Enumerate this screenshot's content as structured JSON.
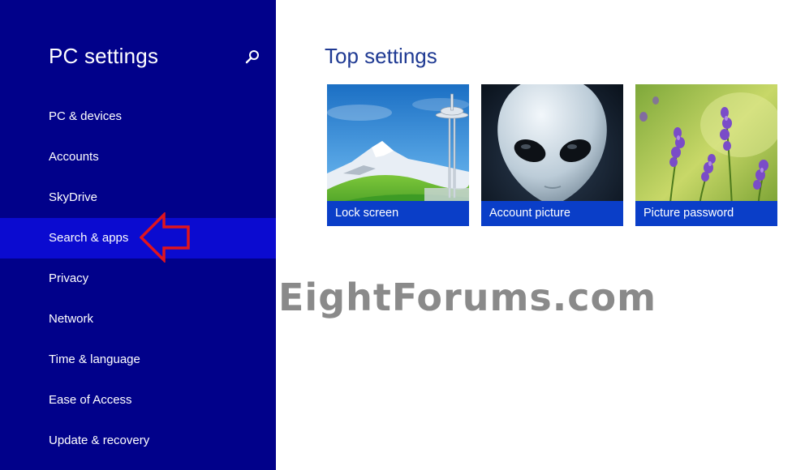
{
  "sidebar": {
    "title": "PC settings",
    "search_icon": "search-icon",
    "items": [
      {
        "label": "PC & devices"
      },
      {
        "label": "Accounts"
      },
      {
        "label": "SkyDrive"
      },
      {
        "label": "Search & apps",
        "selected": true
      },
      {
        "label": "Privacy"
      },
      {
        "label": "Network"
      },
      {
        "label": "Time & language"
      },
      {
        "label": "Ease of Access"
      },
      {
        "label": "Update & recovery"
      }
    ]
  },
  "main": {
    "title": "Top settings",
    "tiles": [
      {
        "label": "Lock screen",
        "image": "space-needle-mountain-image"
      },
      {
        "label": "Account picture",
        "image": "alien-face-image"
      },
      {
        "label": "Picture password",
        "image": "lavender-flowers-image"
      }
    ]
  },
  "watermark": "EightForums.com",
  "colors": {
    "sidebar_bg": "#01018a",
    "selected_item_bg": "#0b0bd0",
    "title_blue": "#1f3a93",
    "tile_caption_bg": "#0a3ec8",
    "annotation_red": "#e0141e"
  }
}
